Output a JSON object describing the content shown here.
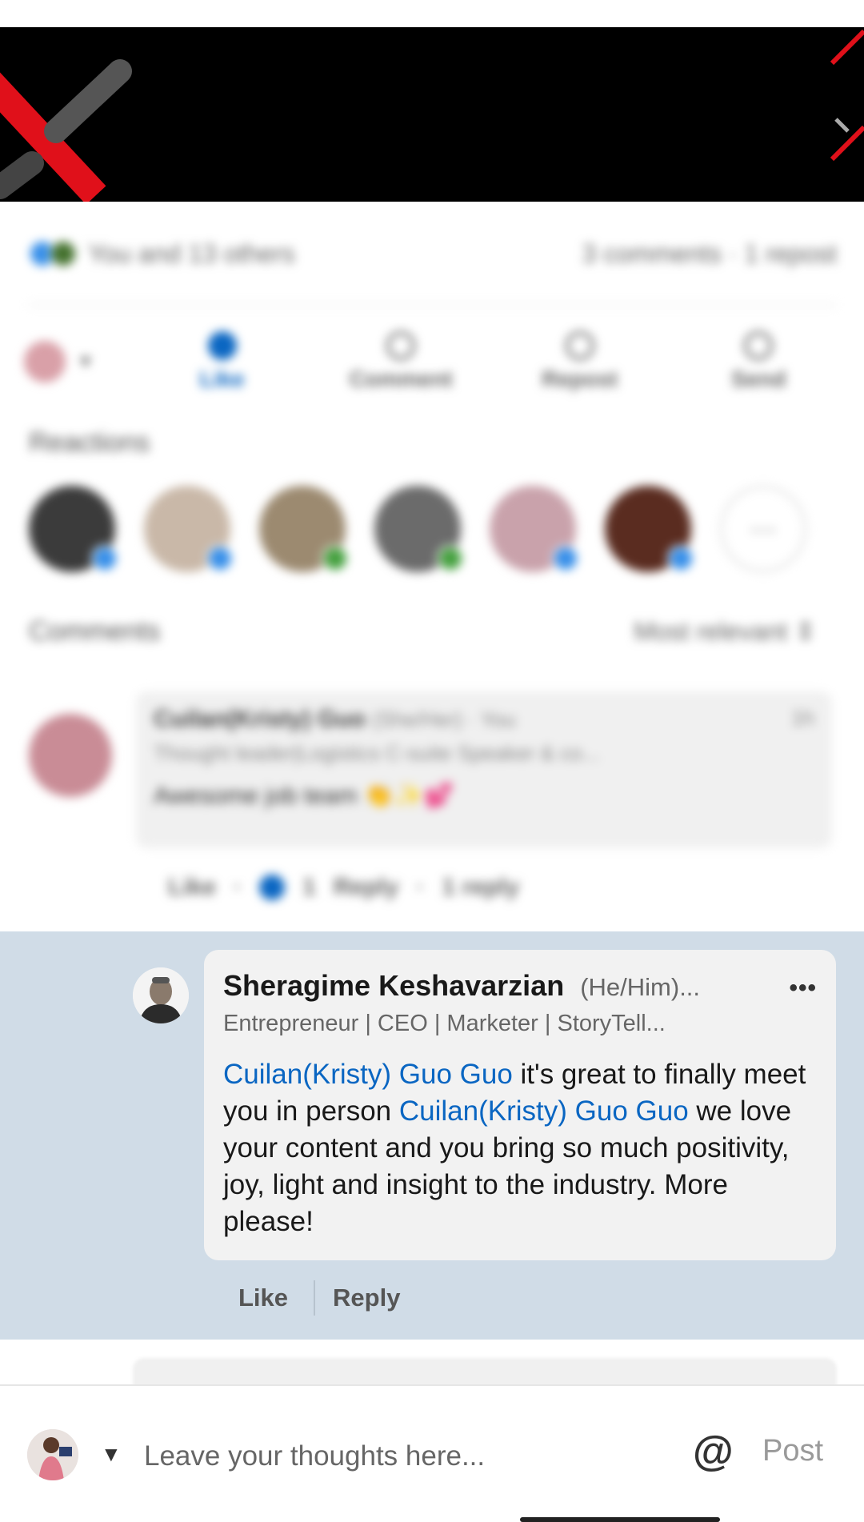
{
  "post_summary": {
    "reactions_text": "You and 13 others",
    "comments_count": "3 comments",
    "reposts_count": "1 repost"
  },
  "actions": {
    "like": "Like",
    "comment": "Comment",
    "repost": "Repost",
    "send": "Send"
  },
  "reactions_section": {
    "title": "Reactions",
    "more": "···"
  },
  "comments_section": {
    "title": "Comments",
    "sort": "Most relevant"
  },
  "first_comment": {
    "author": "Cuilan(Kristy) Guo",
    "pronouns": "(She/Her) · You",
    "time": "1h",
    "headline": "Thought leader|Logistics C-suite Speaker & co...",
    "text": "Awesome job team 👏✨💕",
    "like_label": "Like",
    "reaction_count": "1",
    "reply_label": "Reply",
    "replies": "1 reply"
  },
  "highlighted_comment": {
    "author": "Sheragime Keshavarzian",
    "pronouns": "(He/Him)...",
    "more_icon": "more-dots-icon",
    "headline": "Entrepreneur | CEO | Marketer | StoryTell...",
    "mention": "Cuilan(Kristy) Guo Guo",
    "text_part1": " it's great to finally meet you in person ",
    "text_part2": " we love your content and you bring so much positivity, joy, light and insight to the industry. More please!",
    "like_label": "Like",
    "reply_label": "Reply"
  },
  "composer": {
    "placeholder": "Leave your thoughts here...",
    "mention_symbol": "@",
    "post_label": "Post"
  },
  "colors": {
    "link_blue": "#0a66c2",
    "highlight_bg": "#d0dce7",
    "bubble_bg": "#f2f2f2"
  }
}
